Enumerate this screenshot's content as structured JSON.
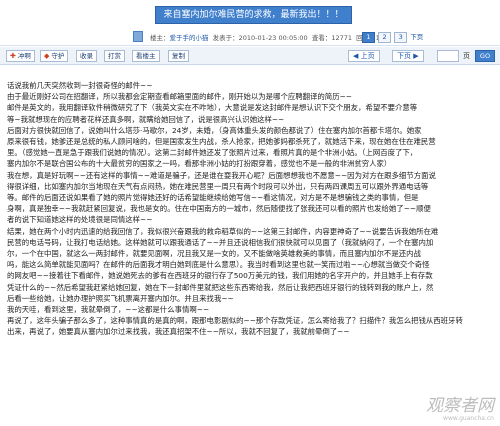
{
  "thread": {
    "title": "来自塞内加尔难民营的求救，最新我出！！！"
  },
  "meta": {
    "author_label": "楼主",
    "author": "爱于手的小猫",
    "posted_label": "发表于",
    "posted_time": "2010-01-23 00:05:00",
    "views_label": "查看",
    "views": "12771",
    "replies_label": "回复",
    "replies": "136",
    "pages": [
      "1",
      "2",
      "3"
    ],
    "next_label": "下页"
  },
  "toolbar": {
    "post_label": "冲啊",
    "guard_label": "守护",
    "fav_label": "收录",
    "print_label": "打赏",
    "view_label": "看楼主",
    "copy_label": "复制",
    "prev_label": "上页",
    "next_label": "下页",
    "page_unit": "页",
    "go_label": "GO"
  },
  "body_lines": [
    "话说我前几天突然收到一封很奇怪的邮件~~",
    "由于最近刚好公司在招翻译，所以我都会定期查看邮箱里面的邮件，刚开始以为是哪个应聘翻译的简历~~",
    "邮件是英文的，我用翻译软件稍微研究了下（我英文实在不咋地），大意说是发这封邮件是想认识下交个朋友，希望不要介意等",
    "等~我就想现在的应聘者花样还真多啊，就瞒给她回信了，说是很高兴认识她这样~~",
    "后面对方很快就回信了，说她叫什么塔莎·马歇尔，24岁，未婚，（身高体重头发的颜色都说了）住在塞内加尔首都卡塔尔。她家",
    "原来很有钱，她爹还是总统的私人顾问啥的，但是国家发生内战，杀人抢家，把她爹妈都杀死了，就她活下来，现在她在住在难民营",
    "里。（感觉她一直是急于跟我们说她的情况）。这第二封邮件她还发了张照片过来，看照片真的是个非洲小姑。（上网百度了下，",
    "塞内加尔不是联合国公布的十大最贫穷的国家之一吗，看那非洲小姑的打扮跟穿着，感觉也不是一般的非洲贫穷人家）",
    "我在想，真是好玩啊~~还有这样的事情~~难道是骗子，还是谁在耍我开心呢？后面想想我也不愿意~~因为对方在跟多细节方面说",
    "得很详细，比如塞内加尔当地现在天气有点闷热，她在难民营里一周只有两个时段可以外出，只有两四课周五可以跟外界通电话等",
    "等。邮件的后面还说如果看了她的照片觉得她还好的话希望能继续给她写信~~看这情况，对方是不是想骗钱之类的事情，但是",
    "身啊，真是独幸~~我就赶紧回复说，我也是女的。住在中国南方的一城市，然后随便找了张我还可以看的照片也发给她了~~顺便",
    "者的说下知道她这样的处境很是同情这样~~",
    "结果，她在两个小时内迅速的给我回信了，我似很兴奋跟我的救命稻草似的~~这第三封邮件，内容更神奇了~~说要告诉我她所在难",
    "民营的电话号码，让我打电话给她。这样她就可以跟我通话了~~并且还说相信我们很快就可以见面了（我就纳闷了，一个在塞内加",
    "尔，一个在中国，就这么一两封邮件，就要见面啊，况且我又是一女的，又不能做啥英雄救美的事情，而且塞内加尔不是还内战",
    "吗，能这么简单就能见面吗？在邮件的后面我才明白她到底是什么意思）。我当时看到这里也就一笑而过啦~~心想就当做交个奇怪",
    "的网友吧~~接着往下看邮件，她说她死去的爹有在西班牙的银行存了500万美元的钱，我们用她的名字开户的，并且她手上有存款",
    "凭证什么的~~然后希望我赶紧给她回复，她在下一封邮件里就把这些东西寄给我，然后让我把西班牙银行的钱转到我的账户上，然",
    "后看一些给她，让她办理护照买飞机票离开塞内加尔。并且来找我~~",
    "我的天哇，看到这里，我就晕倒了，~~这都是什么事情啊~~",
    "再说了，这年头骗子那么多了，这种事情真的是真的啊，跟那电影剧似的~~那个存款凭证，怎么寄给我了？扫描件？我怎么把钱从西班牙转",
    "出来，再说了，她要真从塞内加尔过来找我，我还真招架不住~~所以，我就不回复了，我就前晕倒了~~"
  ],
  "watermark": {
    "site_cn": "观察者网",
    "site_url": "www.guancha.cn"
  },
  "colors": {
    "title_bar_bg": "#3f7fcc",
    "link": "#1b57a6",
    "toolbar_bg": "#eef3fa"
  }
}
